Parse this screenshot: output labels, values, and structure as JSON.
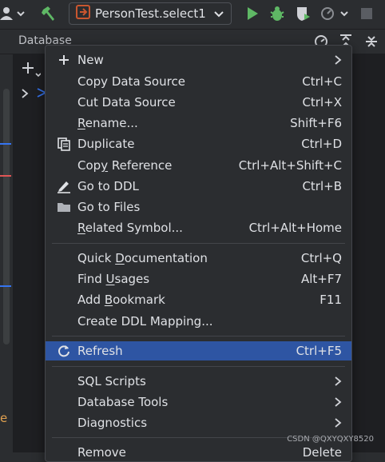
{
  "toolbar": {
    "run_config": "PersonTest.select1"
  },
  "panel": {
    "title": "Database"
  },
  "bottom_glyph": "e",
  "menu": {
    "items": [
      {
        "label": "New",
        "shortcut": "",
        "submenu": true,
        "icon": "plus-icon"
      },
      {
        "label": "Copy Data Source",
        "shortcut": "Ctrl+C"
      },
      {
        "label": "Cut Data Source",
        "shortcut": "Ctrl+X"
      },
      {
        "pre": "",
        "u": "R",
        "post": "ename...",
        "shortcut": "Shift+F6"
      },
      {
        "label": "Duplicate",
        "shortcut": "Ctrl+D",
        "icon": "duplicate-icon"
      },
      {
        "pre": "Cop",
        "u": "y",
        "post": " Reference",
        "shortcut": "Ctrl+Alt+Shift+C"
      },
      {
        "label": "Go to DDL",
        "shortcut": "Ctrl+B",
        "icon": "edit-pencil-icon"
      },
      {
        "label": "Go to Files",
        "shortcut": "",
        "icon": "folder-icon"
      },
      {
        "pre": "",
        "u": "R",
        "post": "elated Symbol...",
        "shortcut": "Ctrl+Alt+Home"
      },
      {
        "pre": "Quick ",
        "u": "D",
        "post": "ocumentation",
        "shortcut": "Ctrl+Q"
      },
      {
        "pre": "Find ",
        "u": "U",
        "post": "sages",
        "shortcut": "Alt+F7"
      },
      {
        "pre": "Add ",
        "u": "B",
        "post": "ookmark",
        "shortcut": "F11"
      },
      {
        "label": "Create DDL Mapping...",
        "shortcut": ""
      },
      {
        "label": "Refresh",
        "shortcut": "Ctrl+F5",
        "icon": "refresh-icon",
        "selected": true
      },
      {
        "label": "SQL Scripts",
        "shortcut": "",
        "submenu": true
      },
      {
        "label": "Database Tools",
        "shortcut": "",
        "submenu": true
      },
      {
        "label": "Diagnostics",
        "shortcut": "",
        "submenu": true
      },
      {
        "label": "Remove",
        "shortcut": "Delete"
      }
    ]
  },
  "watermark": "CSDN @QXYQXY8520",
  "colors": {
    "selection": "#2e55a3",
    "menu_bg": "#2b2d30",
    "run_green": "#5fb865",
    "bug_green": "#5fb865"
  }
}
